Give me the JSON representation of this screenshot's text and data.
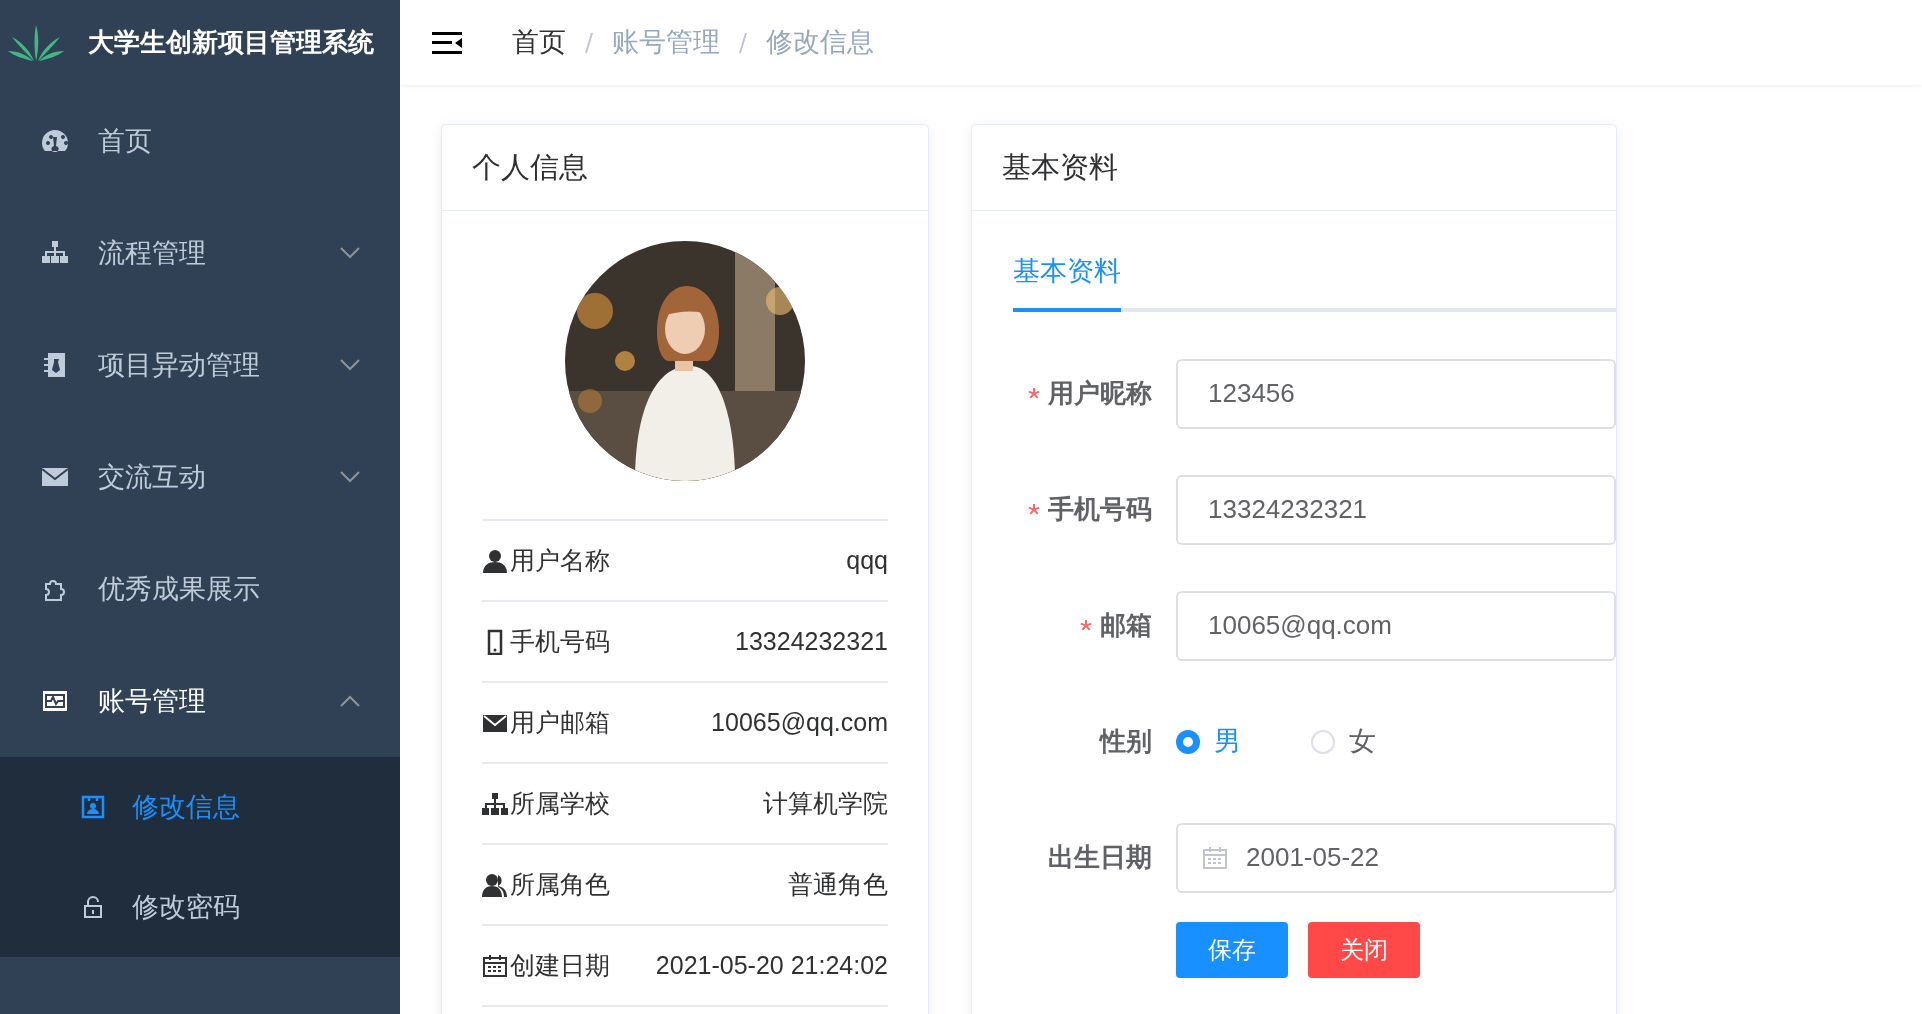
{
  "app": {
    "title": "大学生创新项目管理系统"
  },
  "breadcrumb": [
    {
      "label": "首页",
      "kind": "link"
    },
    {
      "label": "账号管理",
      "kind": "text"
    },
    {
      "label": "修改信息",
      "kind": "text"
    }
  ],
  "sidebar": {
    "items": [
      {
        "label": "首页",
        "expandable": false,
        "expanded": false
      },
      {
        "label": "流程管理",
        "expandable": true,
        "expanded": false
      },
      {
        "label": "项目异动管理",
        "expandable": true,
        "expanded": false
      },
      {
        "label": "交流互动",
        "expandable": true,
        "expanded": false
      },
      {
        "label": "优秀成果展示",
        "expandable": false,
        "expanded": false
      },
      {
        "label": "账号管理",
        "expandable": true,
        "expanded": true,
        "children": [
          {
            "label": "修改信息",
            "selected": true
          },
          {
            "label": "修改密码",
            "selected": false
          }
        ]
      }
    ]
  },
  "profile_card": {
    "title": "个人信息",
    "rows": [
      {
        "label": "用户名称",
        "value": "qqq"
      },
      {
        "label": "手机号码",
        "value": "13324232321"
      },
      {
        "label": "用户邮箱",
        "value": "10065@qq.com"
      },
      {
        "label": "所属学校",
        "value": "计算机学院"
      },
      {
        "label": "所属角色",
        "value": "普通角色"
      },
      {
        "label": "创建日期",
        "value": "2021-05-20 21:24:02"
      }
    ]
  },
  "form_card": {
    "title": "基本资料",
    "tabs": [
      {
        "label": "基本资料",
        "selected": true
      }
    ],
    "fields": [
      {
        "kind": "text",
        "label": "用户昵称",
        "required": true,
        "value": "123456"
      },
      {
        "kind": "text",
        "label": "手机号码",
        "required": true,
        "value": "13324232321"
      },
      {
        "kind": "text",
        "label": "邮箱",
        "required": true,
        "value": "10065@qq.com"
      },
      {
        "kind": "radio",
        "label": "性别",
        "required": false,
        "options": [
          {
            "label": "男",
            "selected": true
          },
          {
            "label": "女",
            "selected": false
          }
        ]
      },
      {
        "kind": "date",
        "label": "出生日期",
        "required": false,
        "value": "2001-05-22"
      }
    ],
    "buttons": [
      {
        "label": "保存",
        "kind": "primary"
      },
      {
        "label": "关闭",
        "kind": "danger"
      }
    ]
  }
}
